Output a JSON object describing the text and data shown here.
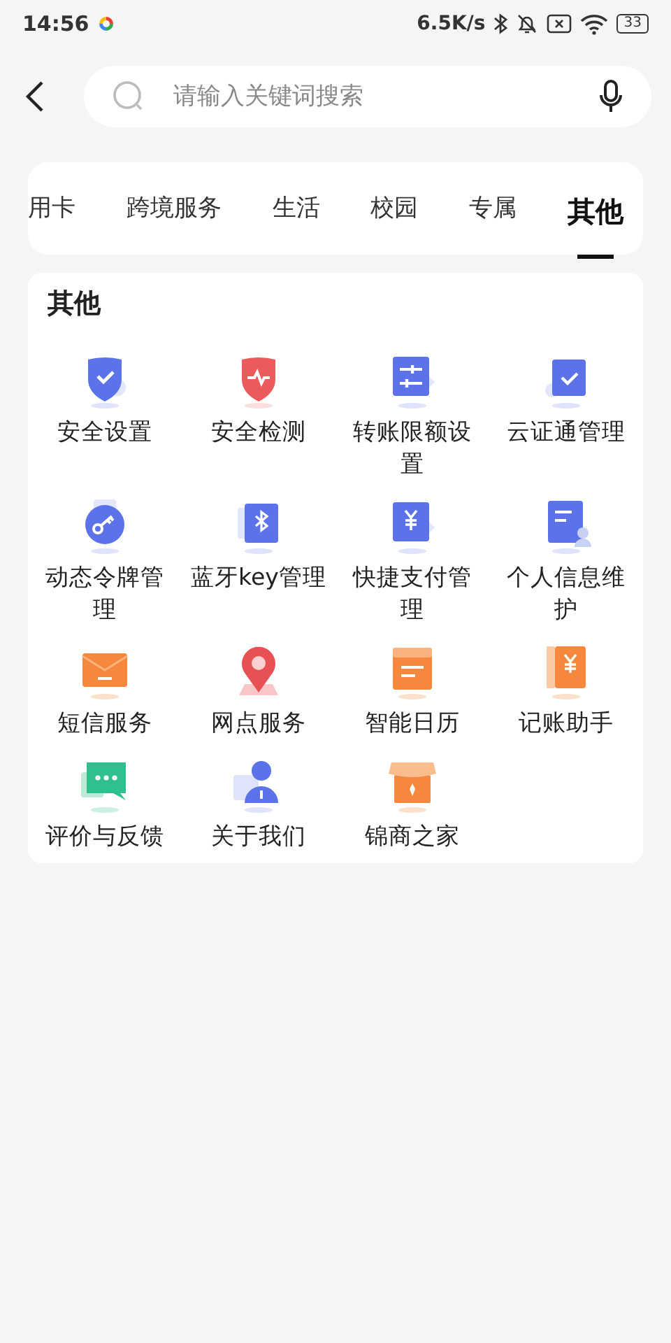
{
  "status_bar": {
    "time": "14:56",
    "speed": "6.5K/s",
    "battery": "33"
  },
  "search": {
    "placeholder": "请输入关键词搜索"
  },
  "tabs": [
    {
      "label": "用卡",
      "selected": false
    },
    {
      "label": "跨境服务",
      "selected": false
    },
    {
      "label": "生活",
      "selected": false
    },
    {
      "label": "校园",
      "selected": false
    },
    {
      "label": "专属",
      "selected": false
    },
    {
      "label": "其他",
      "selected": true
    }
  ],
  "section": {
    "title": "其他",
    "items": [
      {
        "label": "安全设置",
        "kind": "shield-check"
      },
      {
        "label": "安全检测",
        "kind": "shield-pulse"
      },
      {
        "label": "转账限额设置",
        "kind": "sliders"
      },
      {
        "label": "云证通管理",
        "kind": "check-card"
      },
      {
        "label": "动态令牌管理",
        "kind": "key"
      },
      {
        "label": "蓝牙key管理",
        "kind": "bluetooth"
      },
      {
        "label": "快捷支付管理",
        "kind": "yen-card"
      },
      {
        "label": "个人信息维护",
        "kind": "profile"
      },
      {
        "label": "短信服务",
        "kind": "envelope"
      },
      {
        "label": "网点服务",
        "kind": "pin"
      },
      {
        "label": "智能日历",
        "kind": "calendar"
      },
      {
        "label": "记账助手",
        "kind": "ledger"
      },
      {
        "label": "评价与反馈",
        "kind": "chat"
      },
      {
        "label": "关于我们",
        "kind": "person"
      },
      {
        "label": "锦商之家",
        "kind": "shop"
      }
    ]
  }
}
